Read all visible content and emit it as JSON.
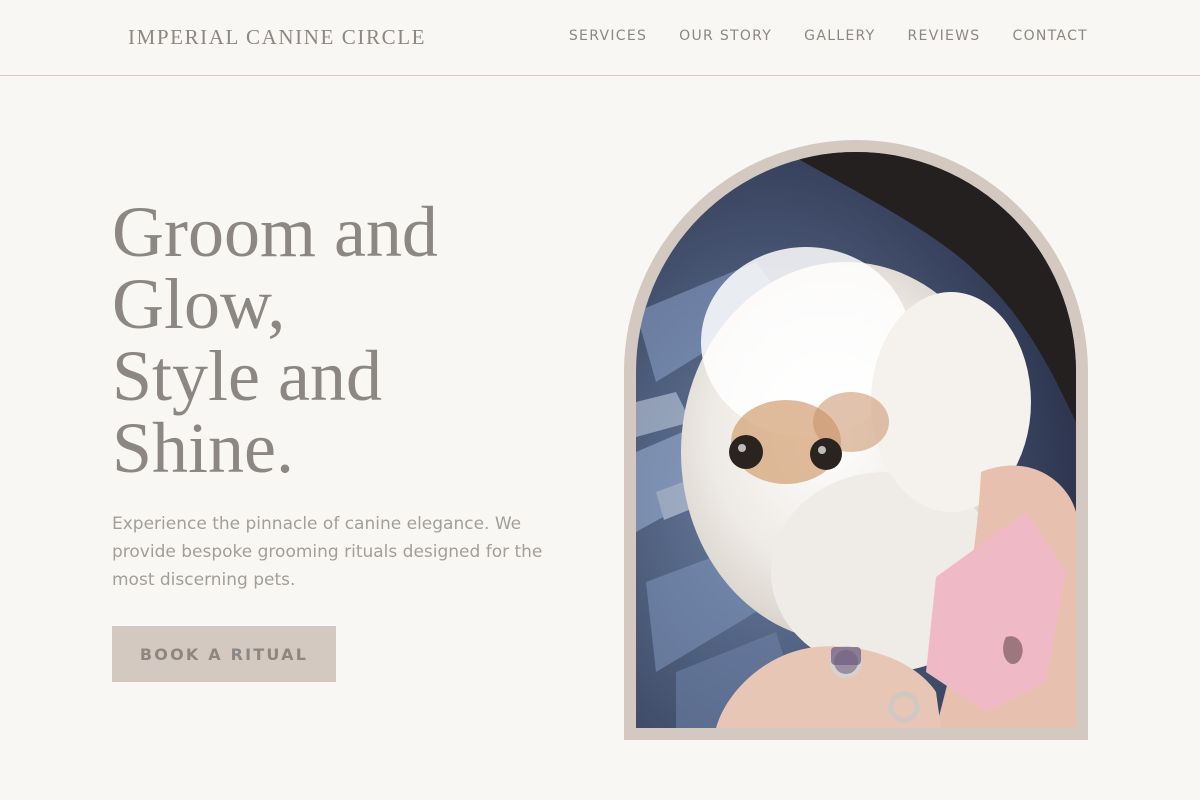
{
  "header": {
    "brand": "IMPERIAL CANINE CIRCLE",
    "nav": [
      "SERVICES",
      "OUR STORY",
      "GALLERY",
      "REVIEWS",
      "CONTACT"
    ]
  },
  "hero": {
    "title_lines": [
      "Groom and",
      "Glow,",
      "Style and",
      "Shine."
    ],
    "description": "Experience the pinnacle of canine elegance. We provide bespoke grooming rituals designed for the most discerning pets.",
    "cta_label": "BOOK A RITUAL"
  },
  "image": {
    "subject": "fluffy white dog held in blanket",
    "icon": "dog-photo"
  },
  "colors": {
    "background": "#f9f7f4",
    "text": "#8d8783",
    "muted_text": "#a49d98",
    "accent": "#d3c9c0",
    "divider": "#dcc6c6"
  }
}
